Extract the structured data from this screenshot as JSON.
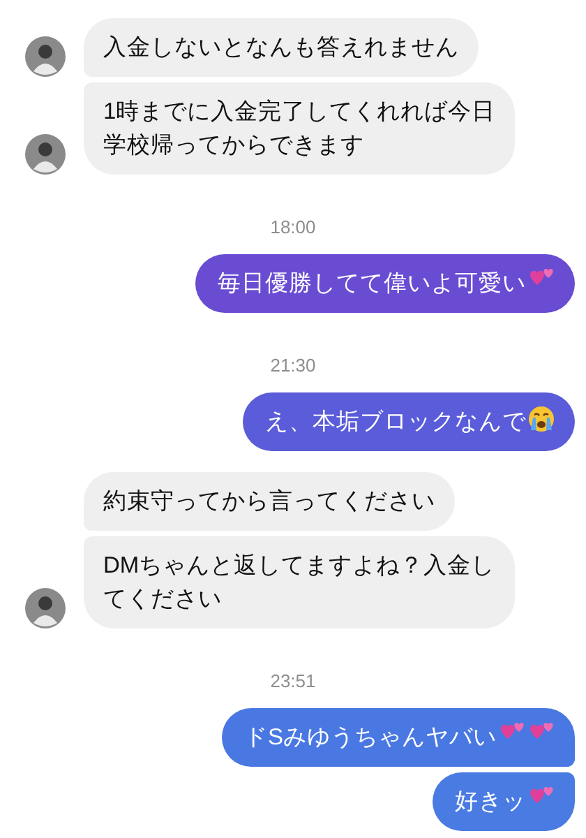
{
  "messages": [
    {
      "kind": "incoming",
      "avatar": true,
      "lines": [
        "入金しないとなんも答えれません"
      ]
    },
    {
      "kind": "incoming",
      "avatar": true,
      "lines": [
        "1時までに入金完了してくれれば今日",
        "学校帰ってからできます"
      ]
    },
    {
      "kind": "time",
      "text": "18:00"
    },
    {
      "kind": "outgoing",
      "color": "#6a4cd2",
      "lines": [
        "毎日優勝してて偉いよ可愛い"
      ],
      "emoji": [
        {
          "kind": "hearts"
        }
      ]
    },
    {
      "kind": "time",
      "text": "21:30"
    },
    {
      "kind": "outgoing",
      "color": "#5a5cd9",
      "lines": [
        "え、本垢ブロックなんで"
      ],
      "emoji": [
        {
          "kind": "crying"
        }
      ]
    },
    {
      "kind": "incoming",
      "avatar": false,
      "lines": [
        "約束守ってから言ってください"
      ]
    },
    {
      "kind": "incoming",
      "avatar": true,
      "lines": [
        "DMちゃんと返してますよね？入金し",
        "てください"
      ]
    },
    {
      "kind": "time",
      "text": "23:51"
    },
    {
      "kind": "outgoing",
      "color": "#4a78e2",
      "lines": [
        "ドSみゆうちゃんヤバい"
      ],
      "emoji": [
        {
          "kind": "hearts"
        },
        {
          "kind": "hearts"
        }
      ]
    },
    {
      "kind": "outgoing",
      "color": "#4a7be3",
      "lines": [
        "好きッ"
      ],
      "emoji": [
        {
          "kind": "hearts"
        }
      ]
    }
  ]
}
